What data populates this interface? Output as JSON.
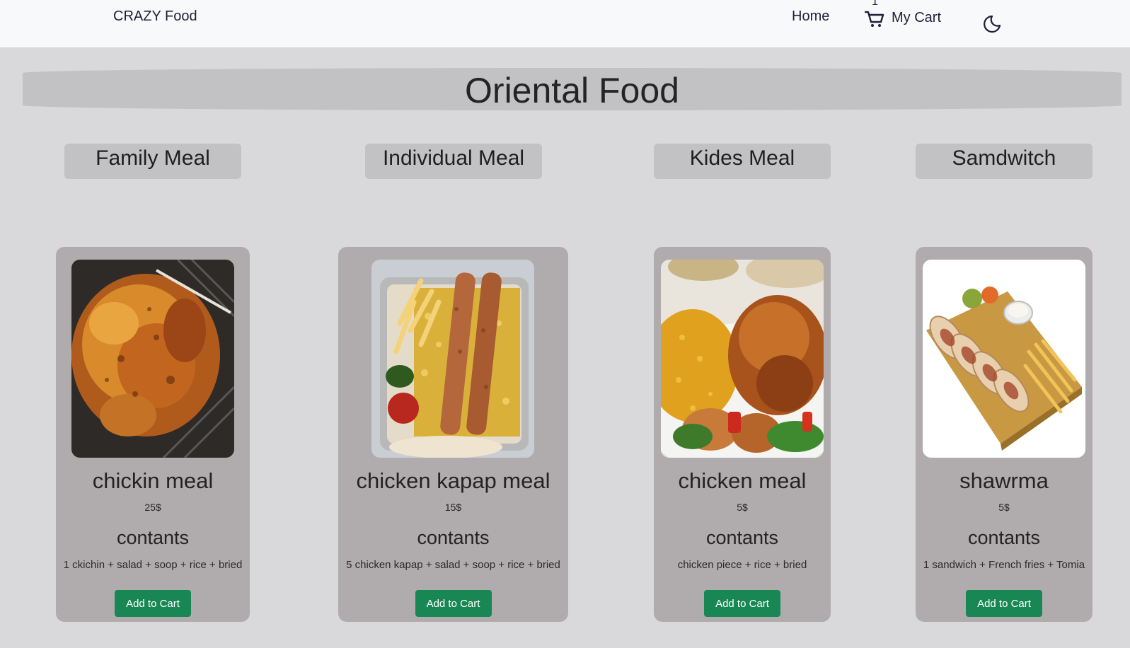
{
  "navbar": {
    "brand": "CRAZY Food",
    "home_label": "Home",
    "cart_label": "My Cart",
    "cart_count": "1"
  },
  "banner": {
    "title": "Oriental Food"
  },
  "categories": [
    {
      "label": "Family Meal"
    },
    {
      "label": "Individual Meal"
    },
    {
      "label": "Kides Meal"
    },
    {
      "label": "Samdwitch"
    }
  ],
  "products": [
    {
      "name": "chickin meal",
      "price": "25$",
      "contents_heading": "contants",
      "contents": "1 ckichin + salad + soop + rice + bried",
      "button": "Add to Cart"
    },
    {
      "name": "chicken kapap meal",
      "price": "15$",
      "contents_heading": "contants",
      "contents": "5 chicken kapap + salad + soop + rice + bried",
      "button": "Add to Cart"
    },
    {
      "name": "chicken meal",
      "price": "5$",
      "contents_heading": "contants",
      "contents": "chicken piece + rice + bried",
      "button": "Add to Cart"
    },
    {
      "name": "shawrma",
      "price": "5$",
      "contents_heading": "contants",
      "contents": "1 sandwich + French fries + Tomia",
      "button": "Add to Cart"
    }
  ],
  "colors": {
    "page_bg": "#d9d9dc",
    "navbar_bg": "#f8f9fa",
    "banner_bg": "#c2c2c5",
    "card_bg": "#b0acad",
    "button_bg": "#198754"
  },
  "icons": [
    "cart-icon",
    "moon-icon"
  ]
}
